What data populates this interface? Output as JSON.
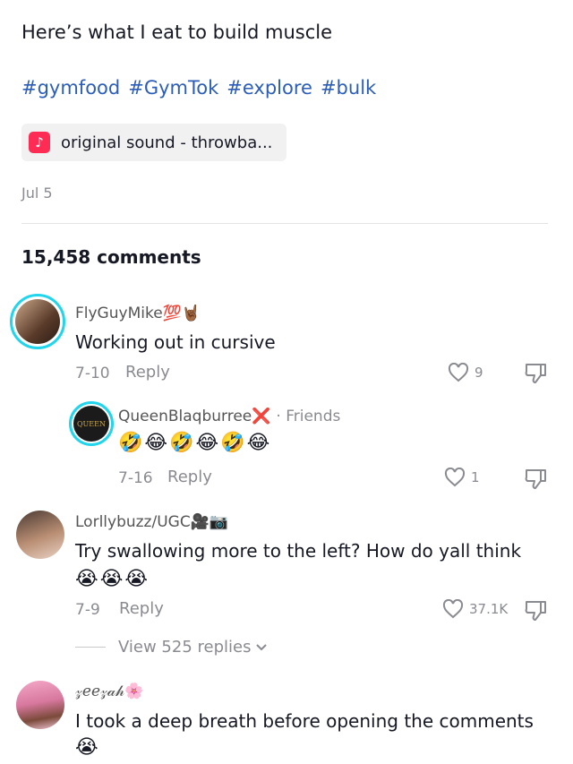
{
  "post": {
    "caption": "Here’s what I eat to build muscle",
    "hashtags": [
      "#gymfood",
      "#GymTok",
      "#explore",
      "#bulk"
    ],
    "sound": "original sound - throwba...",
    "date": "Jul 5"
  },
  "comments_header": {
    "count": "15,458 comments"
  },
  "comments": [
    {
      "user": "FlyGuyMike💯🤘🏾",
      "text": "Working out in cursive",
      "date": "7-10",
      "reply_label": "Reply",
      "likes": "9"
    },
    {
      "user": "QueenBlaqburree❌",
      "tag": "· Friends",
      "avatar_text": "QUEEN",
      "text": "🤣😂🤣😂🤣😂",
      "date": "7-16",
      "reply_label": "Reply",
      "likes": "1"
    },
    {
      "user": "Lorllybuzz/UGC🎥📷",
      "text": "Try swallowing more to the left? How do yall think",
      "emoji": "😭😭😭",
      "date": "7-9",
      "reply_label": "Reply",
      "likes": "37.1K",
      "view_replies": "View 525 replies"
    },
    {
      "user": "𝓏𝑒𝑒𝓏𝒶𝒽🌸",
      "text": "I took a deep breath before opening the comments",
      "emoji": "😭"
    }
  ],
  "colors": {
    "hashtag": "#2b5db9",
    "ring": "#20d5ec",
    "music": "#fe2c55"
  }
}
